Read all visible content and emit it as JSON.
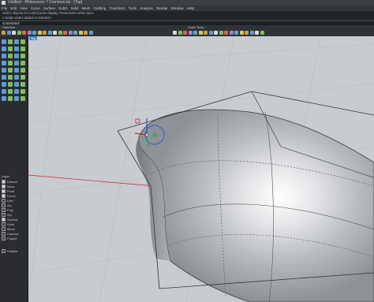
{
  "window": {
    "title": "Untitled - Rhinoceros 7 Commercial - [Top]"
  },
  "menu": [
    "File",
    "Edit",
    "View",
    "Curve",
    "Surface",
    "SubD",
    "Solid",
    "Mesh",
    "Drafting",
    "Transform",
    "Tools",
    "Analysis",
    "Render",
    "Window",
    "Help"
  ],
  "history": {
    "line1": "Select objects for control point display. Press Enter when done",
    "line2": "1 SubD vertex added to selection"
  },
  "command": {
    "label": "Command:"
  },
  "tabs": {
    "left_label": "Standard",
    "right_label": "SubD Tools"
  },
  "viewport": {
    "label": "Top"
  },
  "layers": {
    "header": "Layer",
    "rows": [
      {
        "name": "Default",
        "on": true
      },
      {
        "name": "None",
        "on": true
      },
      {
        "name": "Point",
        "on": true
      },
      {
        "name": "Curve",
        "on": true
      },
      {
        "name": "Line",
        "on": false
      },
      {
        "name": "Arc",
        "on": false
      },
      {
        "name": "Poly",
        "on": false
      },
      {
        "name": "Spl",
        "on": false
      },
      {
        "name": "Surface",
        "on": true
      },
      {
        "name": "Solid",
        "on": false
      },
      {
        "name": "Block",
        "on": false
      },
      {
        "name": "Camera",
        "on": false
      },
      {
        "name": "Project",
        "on": false
      }
    ],
    "footer": "Disable"
  },
  "colors": {
    "accent": "#3d8be0",
    "viewport_bg": "#c8cbd0",
    "axis_x": "#c1272d",
    "axis_y": "#2aa84a",
    "axis_z": "#2f5bd6"
  },
  "icons": {
    "toolbar": [
      "new-icon",
      "open-icon",
      "save-icon",
      "print-icon",
      "cut-icon",
      "copy-icon",
      "paste-icon",
      "undo-icon",
      "redo-icon",
      "pan-icon",
      "rotate-view-icon",
      "zoom-icon",
      "zoom-extents-icon",
      "select-icon",
      "point-icon",
      "line-icon",
      "polyline-icon",
      "curve-icon",
      "circle-icon",
      "arc-icon",
      "rectangle-icon",
      "surface-icon",
      "box-icon",
      "sphere-icon",
      "subd-icon",
      "mesh-icon",
      "move-icon",
      "copy-object-icon",
      "rotate-icon",
      "scale-icon",
      "mirror-icon",
      "boolean-icon",
      "layer-icon",
      "properties-icon",
      "render-icon",
      "material-icon"
    ],
    "left": [
      "select-icon",
      "point-icon",
      "line-icon",
      "curve-icon",
      "circle-icon",
      "arc-icon",
      "rectangle-icon",
      "polygon-icon",
      "surface-icon",
      "box-icon",
      "sphere-icon",
      "cylinder-icon",
      "subd-icon",
      "mesh-icon",
      "extrude-icon",
      "fillet-icon",
      "offset-icon",
      "trim-icon",
      "split-icon",
      "join-icon",
      "explode-icon",
      "move-icon",
      "rotate-icon",
      "scale-icon",
      "mirror-icon",
      "array-icon",
      "boolean-icon",
      "analyze-icon",
      "dimension-icon",
      "text-icon",
      "hatch-icon",
      "block-icon",
      "layer-icon",
      "properties-icon",
      "render-icon",
      "view-icon"
    ]
  }
}
